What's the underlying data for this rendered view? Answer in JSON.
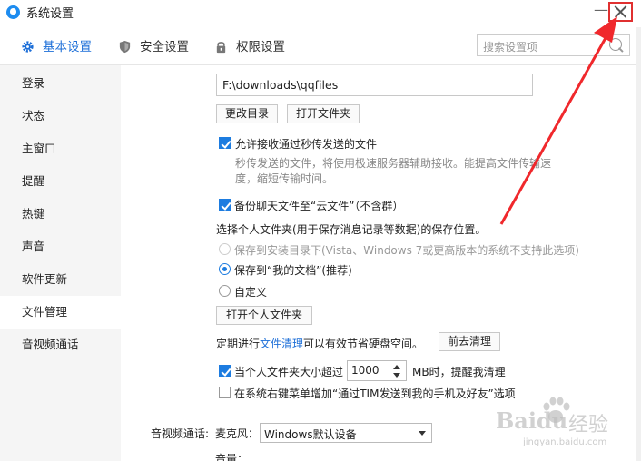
{
  "window": {
    "title": "系统设置",
    "minimize": "—"
  },
  "tabs": [
    {
      "label": "基本设置",
      "icon": "gear-icon",
      "active": true
    },
    {
      "label": "安全设置",
      "icon": "shield-icon",
      "active": false
    },
    {
      "label": "权限设置",
      "icon": "lock-icon",
      "active": false
    }
  ],
  "search": {
    "placeholder": "搜索设置项",
    "icon": "search-icon"
  },
  "sidebar": {
    "items": [
      {
        "label": "登录"
      },
      {
        "label": "状态"
      },
      {
        "label": "主窗口"
      },
      {
        "label": "提醒"
      },
      {
        "label": "热键"
      },
      {
        "label": "声音"
      },
      {
        "label": "软件更新"
      },
      {
        "label": "文件管理",
        "active": true
      },
      {
        "label": "音视频通话"
      }
    ]
  },
  "file_management": {
    "download_path": "F:\\downloads\\qqfiles",
    "change_dir_button": "更改目录",
    "open_folder_button": "打开文件夹",
    "allow_instant_transfer": {
      "label": "允许接收通过秒传发送的文件",
      "checked": true
    },
    "instant_desc_line1": "秒传发送的文件，将使用极速服务器辅助接收。能提高文件传输速",
    "instant_desc_line2": "度，缩短传输时间。",
    "backup_cloud": {
      "label": "备份聊天文件至“云文件”（不含群）",
      "checked": true
    },
    "personal_folder_heading": "选择个人文件夹(用于保存消息记录等数据)的保存位置。",
    "radio_options": [
      {
        "label": "保存到安装目录下(Vista、Windows 7或更高版本的系统不支持此选项)",
        "selected": false,
        "disabled": true
      },
      {
        "label": "保存到“我的文档”(推荐)",
        "selected": true,
        "disabled": false
      },
      {
        "label": "自定义",
        "selected": false,
        "disabled": false
      }
    ],
    "open_personal_folder_button": "打开个人文件夹",
    "cleanup_text_before": "定期进行",
    "cleanup_link": "文件清理",
    "cleanup_text_after": "可以有效节省硬盘空间。",
    "go_cleanup_button": "前去清理",
    "size_limit": {
      "label": "当个人文件夹大小超过",
      "checked": true,
      "value": "1000",
      "unit": "MB时，提醒我清理"
    },
    "context_menu": {
      "label": "在系统右键菜单增加“通过TIM发送到我的手机及好友”选项",
      "checked": false
    }
  },
  "av_call": {
    "section_label": "音视频通话:",
    "mic_label": "麦克风：",
    "mic_device": "Windows默认设备",
    "volume_label": "音量："
  },
  "watermark": {
    "brand": "Baidu",
    "sub": "经验",
    "url": "jingyan.baidu.com"
  },
  "colors": {
    "accent": "#1d6fd8",
    "highlight_box": "#e03030"
  }
}
